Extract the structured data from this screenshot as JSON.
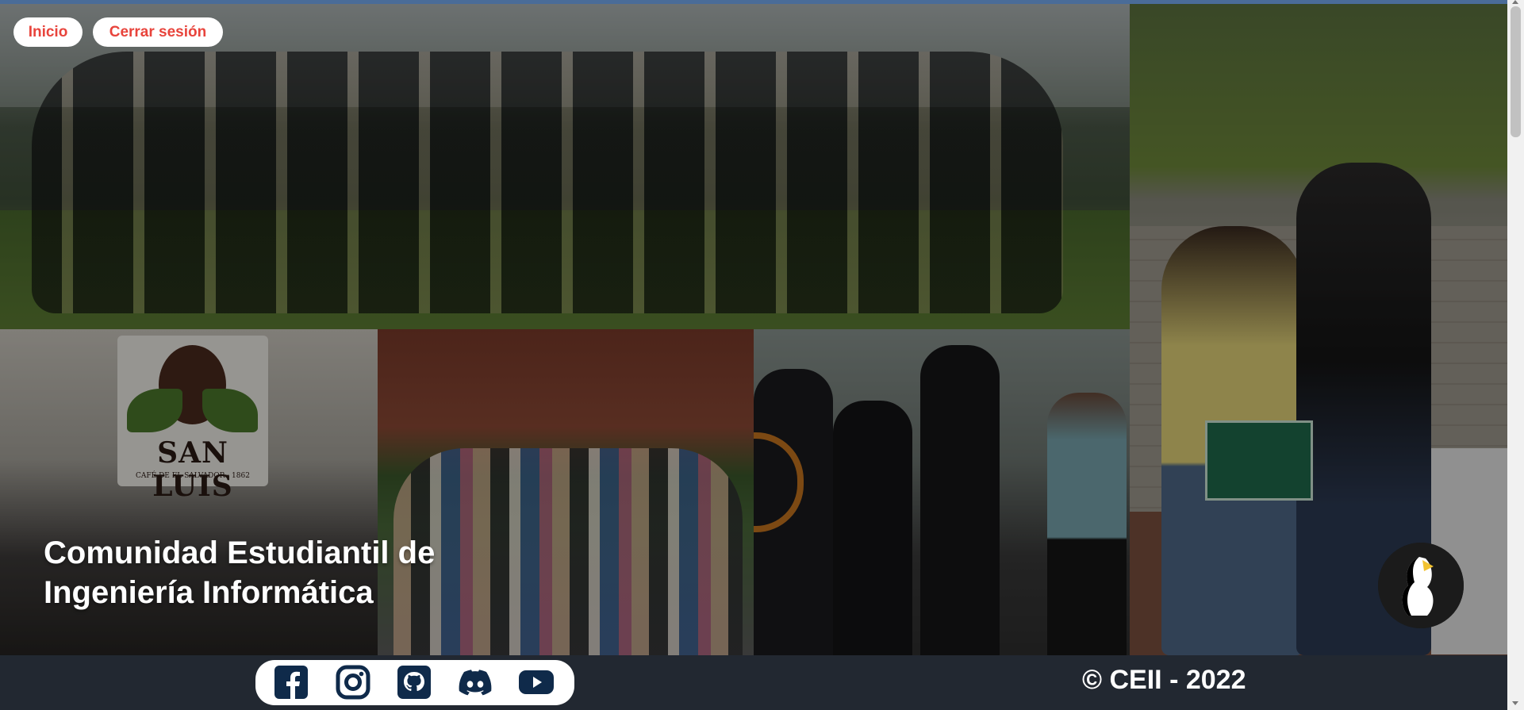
{
  "nav": {
    "home_label": "Inicio",
    "logout_label": "Cerrar sesión"
  },
  "hero": {
    "headline_line1": "Comunidad Estudiantil de",
    "headline_line2": "Ingeniería Informática",
    "photos": [
      {
        "name": "group-photo",
        "icon": "photo"
      },
      {
        "name": "coffee-sign-photo",
        "icon": "photo",
        "sign_text": "SAN LUIS",
        "sign_subtext": "CAFÉ DE EL SALVADOR · 1862"
      },
      {
        "name": "crowd-photo",
        "icon": "photo"
      },
      {
        "name": "open-house-photo",
        "icon": "photo"
      },
      {
        "name": "certificate-photo",
        "icon": "photo"
      }
    ],
    "logo": "ceii-penguin-logo"
  },
  "footer": {
    "social_links": [
      {
        "name": "facebook",
        "icon": "facebook-icon"
      },
      {
        "name": "instagram",
        "icon": "instagram-icon"
      },
      {
        "name": "github",
        "icon": "github-icon"
      },
      {
        "name": "discord",
        "icon": "discord-icon"
      },
      {
        "name": "youtube",
        "icon": "youtube-icon"
      }
    ],
    "copyright": "© CEII - 2022"
  },
  "colors": {
    "accent_red": "#e8443c",
    "footer_bg": "#222831",
    "icon_navy": "#0f2a4a"
  }
}
